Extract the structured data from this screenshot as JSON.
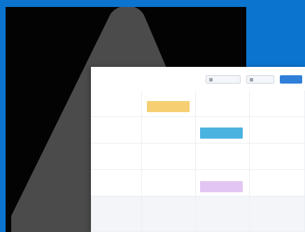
{
  "colors": {
    "page_background": "#0b74cf",
    "hero_background": "#030303",
    "triangle": "#4b4b4b",
    "event_yellow": "#f5cf72",
    "event_blue": "#4ab3e0",
    "event_purple": "#e2c5f2",
    "primary_button": "#2f7fd8"
  },
  "toolbar": {
    "buttons": [
      {
        "label": "",
        "icon": "calendar-icon"
      },
      {
        "label": "",
        "icon": "list-icon"
      },
      {
        "label": ""
      }
    ]
  },
  "weekdays": [
    "",
    "",
    "",
    ""
  ],
  "weeks": [
    [
      "",
      "",
      "",
      ""
    ],
    [
      "",
      "",
      "",
      ""
    ],
    [
      "",
      "",
      "",
      ""
    ],
    [
      "",
      "",
      "",
      ""
    ],
    [
      "",
      "",
      "",
      ""
    ]
  ],
  "events": [
    {
      "label": "",
      "color": "yellow"
    },
    {
      "label": "",
      "color": "blue"
    },
    {
      "label": "",
      "color": "purple"
    }
  ]
}
